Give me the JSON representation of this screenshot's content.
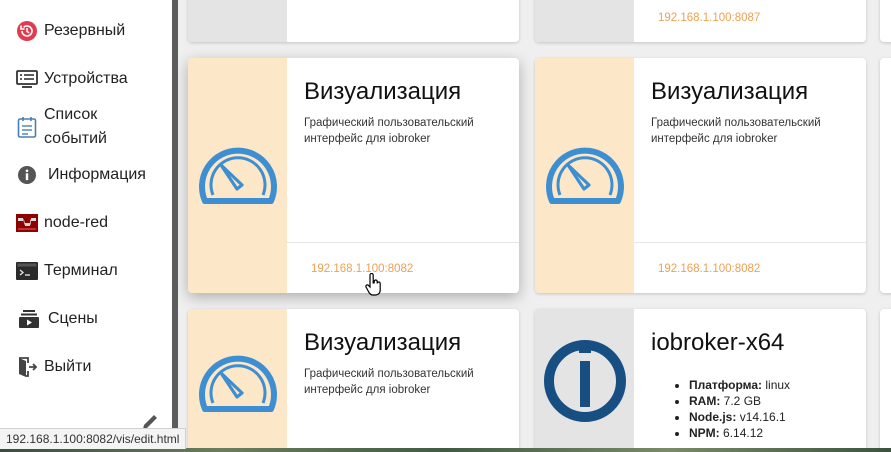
{
  "sidebar": {
    "items": [
      {
        "label": "Резервный",
        "icon": "backup-icon"
      },
      {
        "label": "Устройства",
        "icon": "devices-icon"
      },
      {
        "label": "Список событий",
        "icon": "event-list-icon"
      },
      {
        "label": "Информация",
        "icon": "info-icon"
      },
      {
        "label": "node-red",
        "icon": "node-red-icon"
      },
      {
        "label": "Терминал",
        "icon": "terminal-icon"
      },
      {
        "label": "Сцены",
        "icon": "scenes-icon"
      },
      {
        "label": "Выйти",
        "icon": "logout-icon"
      }
    ],
    "edit_icon": "pencil-icon"
  },
  "status_bar": {
    "url": "192.168.1.100:8082/vis/edit.html"
  },
  "cards": {
    "top_left": {
      "link": ""
    },
    "top_right": {
      "link": "192.168.1.100:8087"
    },
    "vis1": {
      "title": "Визуализация",
      "description": "Графический пользовательский интерфейс для iobroker",
      "link": "192.168.1.100:8082",
      "icon": "gauge-icon"
    },
    "vis2": {
      "title": "Визуализация",
      "description": "Графический пользовательский интерфейс для iobroker",
      "link": "192.168.1.100:8082",
      "icon": "gauge-icon"
    },
    "vis3": {
      "title": "Визуализация",
      "description": "Графический пользовательский интерфейс для iobroker",
      "icon": "gauge-icon"
    },
    "host": {
      "title": "iobroker-x64",
      "icon": "iobroker-logo-icon",
      "info": [
        {
          "key": "Платформа:",
          "value": "linux"
        },
        {
          "key": "RAM:",
          "value": "7.2 GB"
        },
        {
          "key": "Node.js:",
          "value": "v14.16.1"
        },
        {
          "key": "NPM:",
          "value": "6.14.12"
        }
      ]
    }
  },
  "colors": {
    "accent_link": "#f0a050",
    "vis_media_bg": "#fde7c9",
    "gauge_blue": "#3d8fd1",
    "backup_red": "#e03c4f",
    "iobroker_blue": "#174f82"
  }
}
